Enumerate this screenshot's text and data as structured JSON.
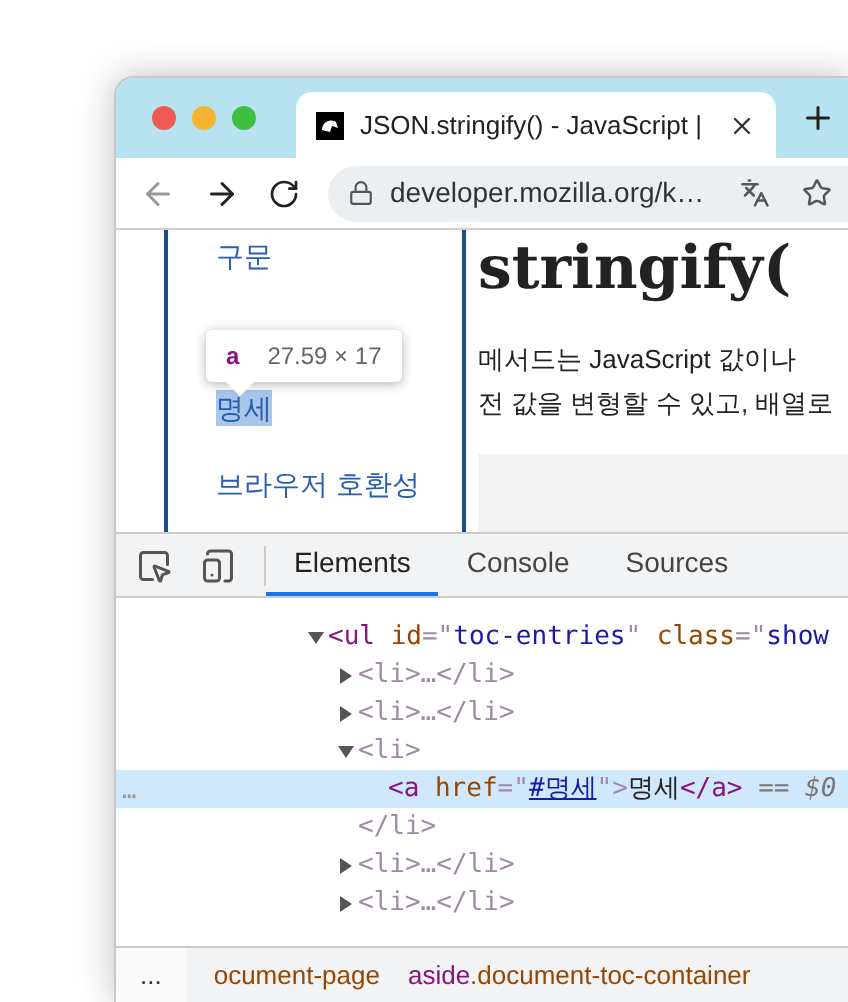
{
  "browser": {
    "tab": {
      "title": "JSON.stringify() - JavaScript | ",
      "selected": true
    },
    "address": "developer.mozilla.org/k…"
  },
  "page": {
    "toc": [
      {
        "label": "구문",
        "selected": false
      },
      {
        "label": "명세",
        "selected": true
      },
      {
        "label": "브라우저 호환성",
        "selected": false
      }
    ],
    "tooltip": {
      "tag": "a",
      "size": "27.59 × 17"
    },
    "heading": "stringify(",
    "paragraph": [
      "메서드는 JavaScript 값이나",
      "전 값을 변형할 수 있고, 배열로"
    ]
  },
  "devtools": {
    "tabs": [
      {
        "label": "Elements",
        "selected": true
      },
      {
        "label": "Console",
        "selected": false
      },
      {
        "label": "Sources",
        "selected": false
      }
    ],
    "tree": [
      {
        "expanded": true,
        "selected": false,
        "open": [
          {
            "kind": "tag",
            "text": "<ul "
          },
          {
            "kind": "attr",
            "text": "id"
          },
          {
            "kind": "punct",
            "text": "=\""
          },
          {
            "kind": "value",
            "text": "toc-entries"
          },
          {
            "kind": "punct",
            "text": "\" "
          },
          {
            "kind": "attr",
            "text": "class"
          },
          {
            "kind": "punct",
            "text": "=\""
          },
          {
            "kind": "value",
            "text": "show"
          }
        ],
        "children": [
          {
            "expanded": false,
            "selected": false,
            "open": [
              {
                "kind": "punct",
                "text": "<li>…</li>"
              }
            ]
          },
          {
            "expanded": false,
            "selected": false,
            "open": [
              {
                "kind": "punct",
                "text": "<li>…</li>"
              }
            ]
          },
          {
            "expanded": true,
            "selected": false,
            "open": [
              {
                "kind": "punct",
                "text": "<li>"
              }
            ],
            "children": [
              {
                "selected": true,
                "open": [
                  {
                    "kind": "tag",
                    "text": "<a "
                  },
                  {
                    "kind": "attr",
                    "text": "href"
                  },
                  {
                    "kind": "punct",
                    "text": "=\""
                  },
                  {
                    "kind": "link",
                    "text": "#명세"
                  },
                  {
                    "kind": "punct",
                    "text": "\">"
                  },
                  {
                    "kind": "text",
                    "text": "명세"
                  },
                  {
                    "kind": "tag",
                    "text": "</a>"
                  },
                  {
                    "kind": "muted",
                    "text": " == $0"
                  }
                ]
              }
            ],
            "close": [
              {
                "kind": "punct",
                "text": "</li>"
              }
            ]
          },
          {
            "expanded": false,
            "selected": false,
            "open": [
              {
                "kind": "punct",
                "text": "<li>…</li>"
              }
            ]
          },
          {
            "expanded": false,
            "selected": false,
            "open": [
              {
                "kind": "punct",
                "text": "<li>…</li>"
              }
            ]
          }
        ]
      }
    ],
    "row_menu": "…",
    "breadcrumbs_menu": "...",
    "breadcrumbs": [
      [
        {
          "kind": "attr",
          "text": "ocument-page"
        }
      ],
      [
        {
          "kind": "tag",
          "text": "aside"
        },
        {
          "kind": "attr",
          "text": ".document-toc-container"
        }
      ]
    ]
  }
}
